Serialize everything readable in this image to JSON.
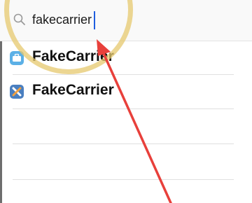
{
  "search": {
    "value": "fakecarrier",
    "icon": "search-icon"
  },
  "results": [
    {
      "label": "FakeCarrier",
      "icon": "briefcase-app-icon",
      "icon_color": "#5bb0e6"
    },
    {
      "label": "FakeCarrier",
      "icon": "tools-app-icon",
      "icon_color": "#4a7fc0"
    }
  ],
  "annotation": {
    "ring_color": "#e6c86e",
    "arrow_color": "#e8403b"
  }
}
